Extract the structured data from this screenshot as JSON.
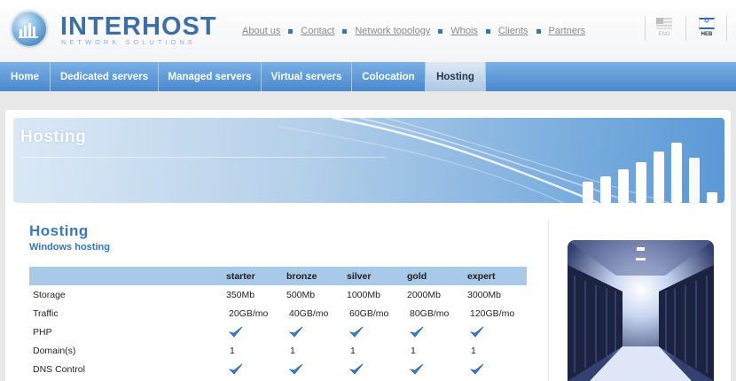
{
  "logo": {
    "name": "INTERHOST",
    "tagline": "NETWORK SOLUTIONS"
  },
  "topnav": [
    "About us",
    "Contact",
    "Network topology",
    "Whois",
    "Clients",
    "Partners"
  ],
  "languages": [
    {
      "code": "ENG",
      "active": false
    },
    {
      "code": "HEB",
      "active": true
    }
  ],
  "mainnav": [
    {
      "label": "Home",
      "active": false
    },
    {
      "label": "Dedicated servers",
      "active": false
    },
    {
      "label": "Managed servers",
      "active": false
    },
    {
      "label": "Virtual servers",
      "active": false
    },
    {
      "label": "Colocation",
      "active": false
    },
    {
      "label": "Hosting",
      "active": true
    }
  ],
  "banner": {
    "title": "Hosting"
  },
  "content": {
    "title": "Hosting",
    "subtitle": "Windows hosting",
    "table": {
      "columns": [
        "starter",
        "bronze",
        "silver",
        "gold",
        "expert"
      ],
      "rows": [
        {
          "label": "Storage",
          "values": [
            "350Mb",
            "500Mb",
            "1000Mb",
            "2000Mb",
            "3000Mb"
          ]
        },
        {
          "label": "Traffic",
          "values": [
            "20GB/mo",
            "40GB/mo",
            "60GB/mo",
            "80GB/mo",
            "120GB/mo"
          ]
        },
        {
          "label": "PHP",
          "values": [
            "check",
            "check",
            "check",
            "check",
            "check"
          ]
        },
        {
          "label": "Domain(s)",
          "values": [
            "1",
            "1",
            "1",
            "1",
            "1"
          ]
        },
        {
          "label": "DNS Control",
          "values": [
            "check",
            "check",
            "check",
            "check",
            "check"
          ]
        }
      ]
    }
  },
  "colors": {
    "nav_blue": "#4a88cd",
    "heading_blue": "#3978bf",
    "table_header": "#a9c9ea",
    "check_blue": "#3a7fc8"
  }
}
